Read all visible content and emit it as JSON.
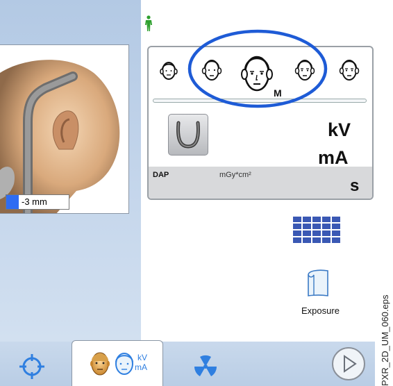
{
  "header": {
    "figure_icon": "standing-person-icon"
  },
  "patient_sizes": {
    "icons": [
      "child-face-icon",
      "small-face-icon",
      "medium-face-icon",
      "large-face-icon",
      "xlarge-face-icon"
    ],
    "selected_label": "M"
  },
  "settings": {
    "kv_label": "kV",
    "ma_label": "mA",
    "dap_label": "DAP",
    "dap_unit": "mGy*cm²",
    "time_unit": "s",
    "bite_block_icon": "bite-block-icon"
  },
  "positioning": {
    "offset_value": "-3 mm"
  },
  "exposure": {
    "label": "Exposure",
    "icon": "exposure-icon"
  },
  "bottom_bar": {
    "tabs": [
      "positioning-target-icon",
      "patient-kv-ma-icon",
      "radiation-icon"
    ],
    "kv_small": "kV",
    "ma_small": "mA",
    "play_icon": "play-icon"
  },
  "figure_id": "PXR_2D_UM_060.eps",
  "colors": {
    "accent_blue": "#1e5bd6",
    "figure_green": "#2ea02e",
    "grid_blue": "#3a58b4"
  }
}
